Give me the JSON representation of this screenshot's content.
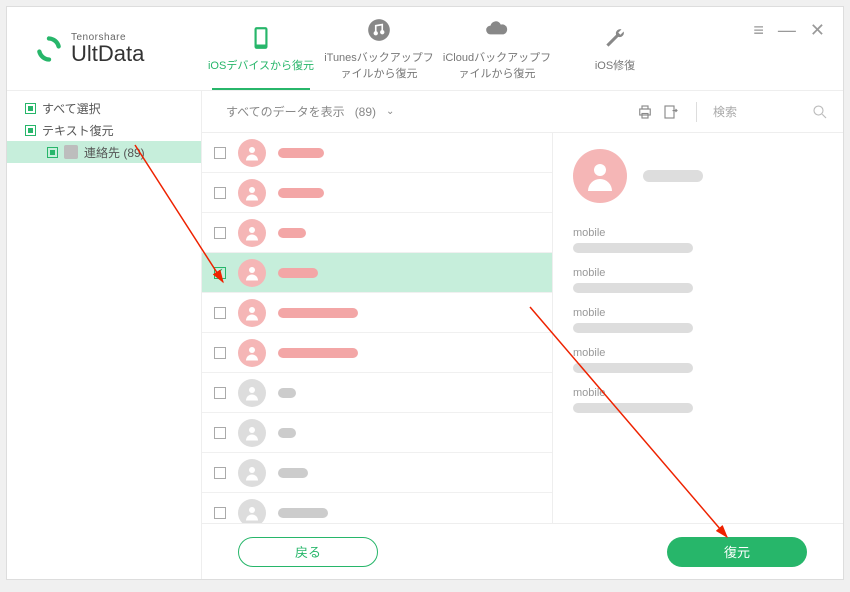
{
  "logo": {
    "brand": "Tenorshare",
    "name": "UltData"
  },
  "tabs": [
    {
      "label": "iOSデバイスから復元",
      "active": true
    },
    {
      "label": "iTunesバックアップファイルから復元",
      "active": false
    },
    {
      "label": "iCloudバックアップファイルから復元",
      "active": false
    },
    {
      "label": "iOS修復",
      "active": false
    }
  ],
  "sidebar": {
    "select_all": "すべて選択",
    "text_recovery": "テキスト復元",
    "contacts": "連絡先 (89)"
  },
  "toolbar": {
    "filter_label": "すべてのデータを表示",
    "filter_count": "(89)",
    "search_placeholder": "検索"
  },
  "contacts": [
    {
      "checked": false,
      "deleted": true,
      "name_width": 46
    },
    {
      "checked": false,
      "deleted": true,
      "name_width": 46
    },
    {
      "checked": false,
      "deleted": true,
      "name_width": 28
    },
    {
      "checked": true,
      "deleted": true,
      "name_width": 40,
      "selected": true
    },
    {
      "checked": false,
      "deleted": true,
      "name_width": 80
    },
    {
      "checked": false,
      "deleted": true,
      "name_width": 80
    },
    {
      "checked": false,
      "deleted": false,
      "name_width": 18
    },
    {
      "checked": false,
      "deleted": false,
      "name_width": 18
    },
    {
      "checked": false,
      "deleted": false,
      "name_width": 30
    },
    {
      "checked": false,
      "deleted": false,
      "name_width": 50
    }
  ],
  "detail": {
    "fields": [
      "mobile",
      "mobile",
      "mobile",
      "mobile",
      "mobile"
    ]
  },
  "footer": {
    "back": "戻る",
    "recover": "復元"
  },
  "colors": {
    "accent": "#27b66a"
  }
}
